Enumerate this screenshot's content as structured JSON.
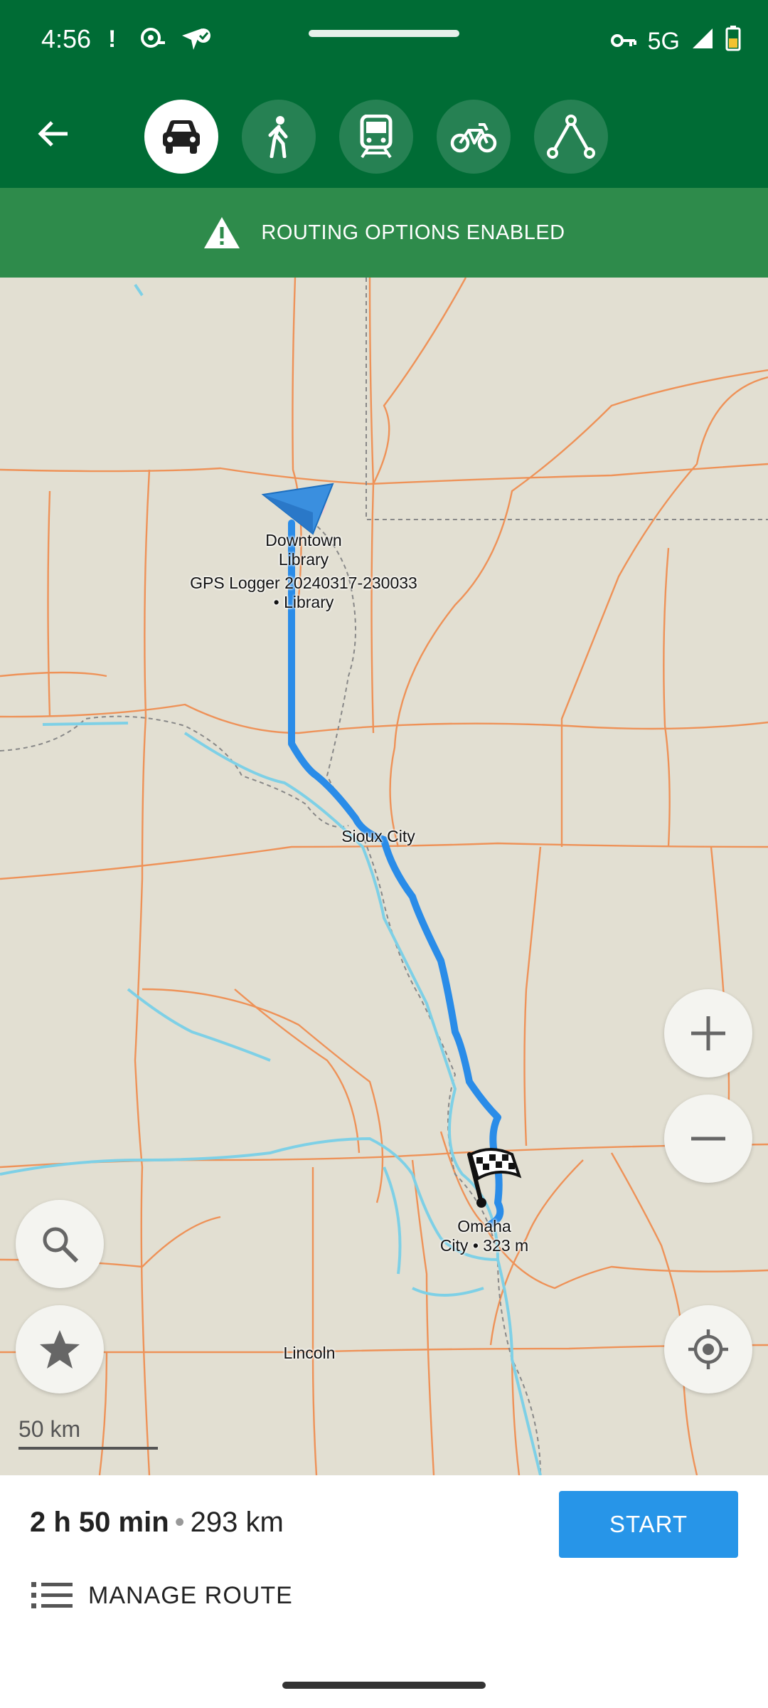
{
  "status_bar": {
    "time": "4:56",
    "network": "5G",
    "icons": [
      "alert-icon",
      "hotspot-icon",
      "location-check-icon",
      "vpn-key-icon",
      "signal-icon",
      "battery-icon"
    ]
  },
  "modes": [
    {
      "name": "car",
      "icon": "car-icon",
      "active": true
    },
    {
      "name": "walk",
      "icon": "pedestrian-icon",
      "active": false
    },
    {
      "name": "transit",
      "icon": "train-icon",
      "active": false
    },
    {
      "name": "bike",
      "icon": "bicycle-icon",
      "active": false
    },
    {
      "name": "ruler",
      "icon": "route-planner-icon",
      "active": false
    }
  ],
  "banner": {
    "text": "ROUTING OPTIONS ENABLED",
    "icon": "warning-icon"
  },
  "map": {
    "labels": {
      "start_name": "Downtown\nLibrary",
      "start_detail": "GPS Logger 20240317-230033\n• Library",
      "sioux_city": "Sioux City",
      "destination": "Omaha\nCity • 323 m",
      "lincoln": "Lincoln"
    },
    "scale": "50 km",
    "route_color": "#2a8ce8",
    "road_color": "#f08a4b",
    "water_color": "#7ed0e6",
    "land_color": "#e2dfd2"
  },
  "route": {
    "duration": "2 h 50 min",
    "separator": "•",
    "distance": "293 km",
    "start_label": "START",
    "manage_label": "MANAGE ROUTE"
  }
}
